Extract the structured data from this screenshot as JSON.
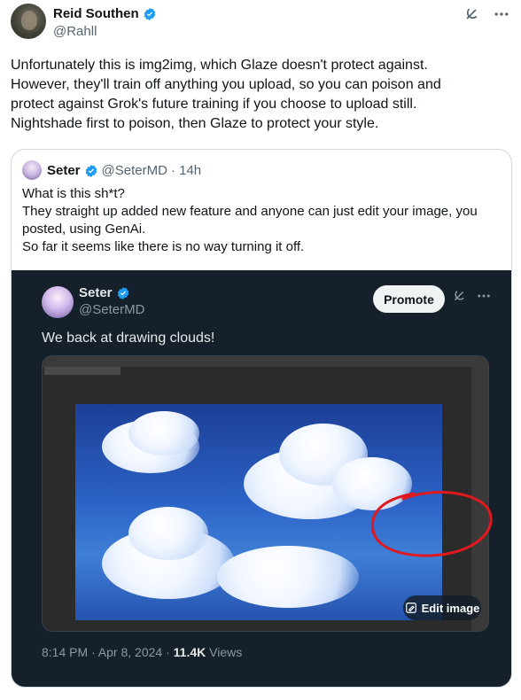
{
  "outer": {
    "name": "Reid Southen",
    "handle": "@Rahll",
    "text": "Unfortunately this is img2img, which Glaze doesn't protect against.\nHowever, they'll train off anything you upload, so you can poison and\nprotect against Grok's future training if you choose to upload still.\nNightshade first to poison, then Glaze to protect your style."
  },
  "quote": {
    "name": "Seter",
    "handle": "@SeterMD",
    "time": "· 14h",
    "text": "What is this sh*t?\nThey straight up added new feature and anyone can just edit your image, you\nposted, using GenAi.\nSo far it seems like there is no way turning it off."
  },
  "embedded": {
    "name": "Seter",
    "handle": "@SeterMD",
    "promote_label": "Promote",
    "text": "We back at drawing clouds!",
    "edit_label": "Edit image",
    "date": "8:14 PM · Apr 8, 2024 · ",
    "views_count": "11.4K",
    "views_label": " Views"
  },
  "colors": {
    "verified": "#1d9bf0",
    "dark_bg": "#15202b",
    "annotation_red": "#e0191e"
  },
  "icons": [
    "verified-badge-icon",
    "grok-icon",
    "more-icon",
    "edit-image-icon"
  ]
}
